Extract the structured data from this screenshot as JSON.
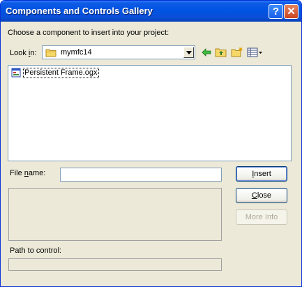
{
  "window": {
    "title": "Components and Controls Gallery",
    "help_label": "?",
    "close_label": "✕"
  },
  "instruction": "Choose a component to insert into your project:",
  "look_in": {
    "label_prefix": "Look ",
    "label_accel": "i",
    "label_suffix": "n:",
    "value": "mymfc14"
  },
  "toolbar": {
    "icons": [
      "back-icon",
      "up-folder-icon",
      "new-folder-icon",
      "view-menu-icon"
    ]
  },
  "files": [
    {
      "name": "Persistent Frame.ogx",
      "icon": "ogx-file-icon"
    }
  ],
  "file_name": {
    "label_prefix": "File ",
    "label_accel": "n",
    "label_suffix": "ame:",
    "value": ""
  },
  "path_label": "Path to control:",
  "path_value": "",
  "buttons": {
    "insert_prefix": "",
    "insert_accel": "I",
    "insert_suffix": "nsert",
    "close_prefix": "",
    "close_accel": "C",
    "close_suffix": "lose",
    "more_info": "More Info"
  },
  "colors": {
    "titlebar": "#0054E3",
    "dialog_bg": "#ECE9D8",
    "field_border": "#7F9DB9"
  }
}
